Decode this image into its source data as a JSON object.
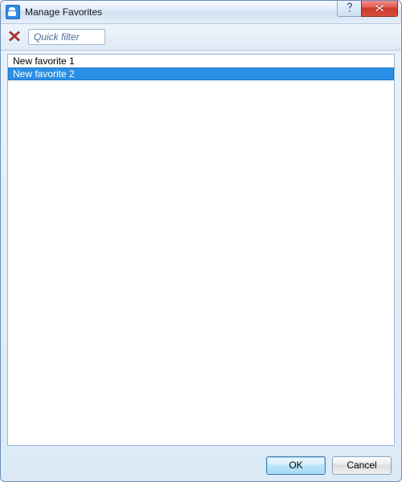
{
  "window": {
    "title": "Manage Favorites"
  },
  "toolbar": {
    "filter_placeholder": "Quick filter"
  },
  "list": {
    "items": [
      {
        "label": "New favorite 1",
        "selected": false
      },
      {
        "label": "New favorite 2",
        "selected": true
      }
    ]
  },
  "footer": {
    "ok_label": "OK",
    "cancel_label": "Cancel"
  },
  "icons": {
    "app": "person-icon",
    "help": "help-icon",
    "close": "close-icon",
    "delete": "delete-x-icon"
  },
  "colors": {
    "selection": "#2a8fe6",
    "frame": "#6a8fb5",
    "delete_icon": "#c0392b"
  }
}
